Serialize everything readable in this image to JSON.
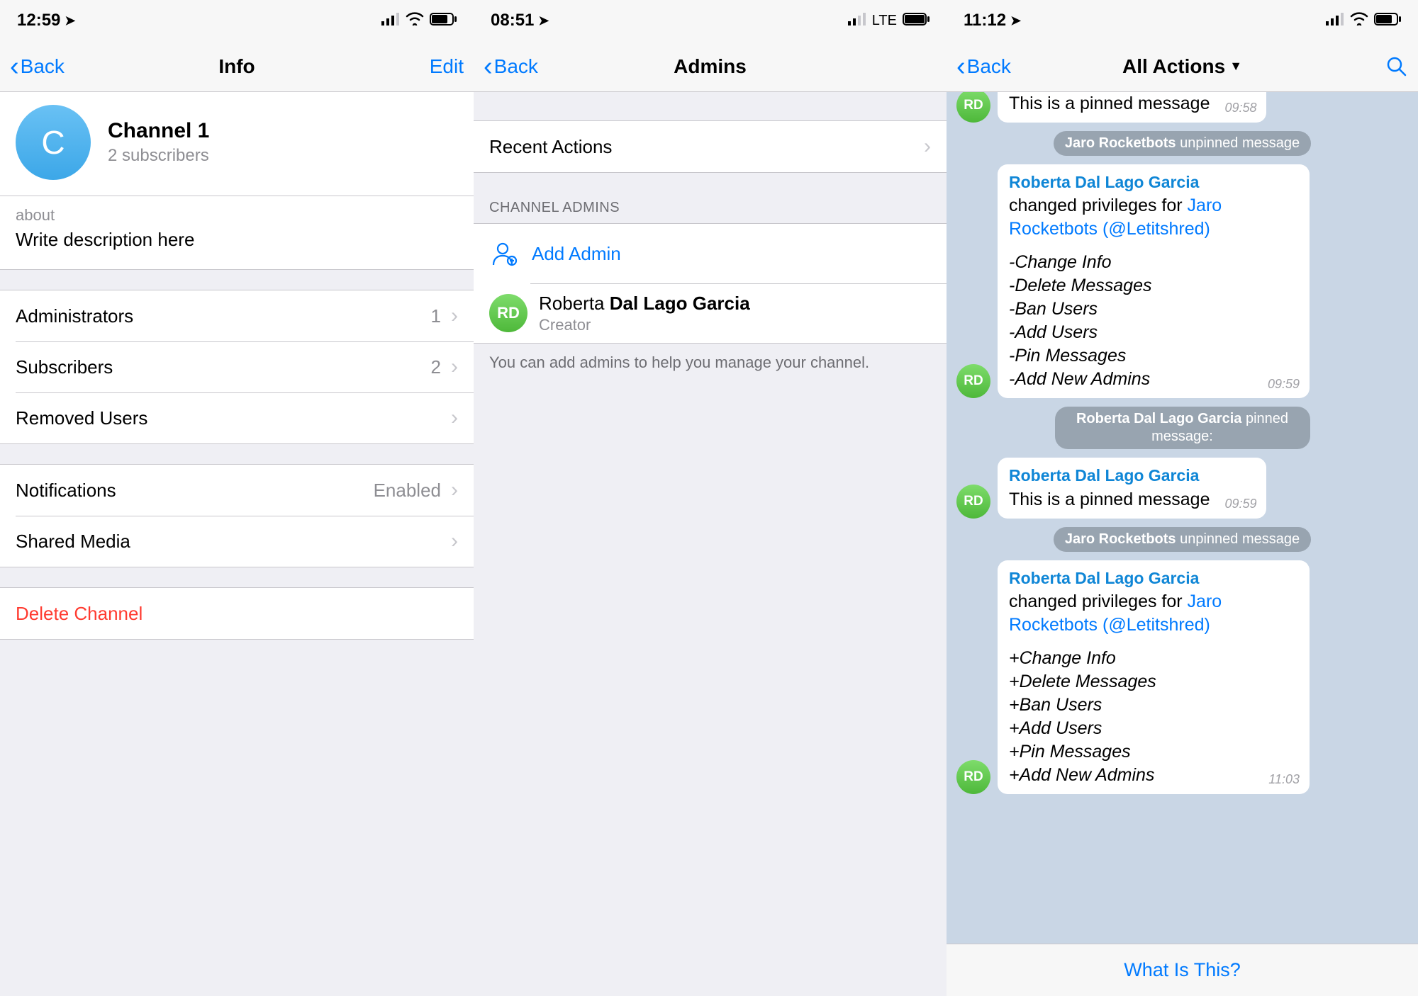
{
  "screen1": {
    "status": {
      "time": "12:59",
      "carrier": ""
    },
    "nav": {
      "back": "Back",
      "title": "Info",
      "edit": "Edit"
    },
    "channel": {
      "avatar_letter": "C",
      "name": "Channel 1",
      "subscribers": "2 subscribers"
    },
    "about": {
      "label": "about",
      "text": "Write description here"
    },
    "rows": {
      "admins_label": "Administrators",
      "admins_value": "1",
      "subs_label": "Subscribers",
      "subs_value": "2",
      "removed_label": "Removed Users",
      "notif_label": "Notifications",
      "notif_value": "Enabled",
      "shared_label": "Shared Media",
      "delete_label": "Delete Channel"
    }
  },
  "screen2": {
    "status": {
      "time": "08:51",
      "net": "LTE"
    },
    "nav": {
      "back": "Back",
      "title": "Admins"
    },
    "recent_actions": "Recent Actions",
    "section_header": "CHANNEL ADMINS",
    "add_admin": "Add Admin",
    "admin": {
      "initials": "RD",
      "first": "Roberta ",
      "last": "Dal Lago Garcia",
      "role": "Creator"
    },
    "footer": "You can add admins to help you manage your channel."
  },
  "screen3": {
    "status": {
      "time": "11:12"
    },
    "nav": {
      "back": "Back",
      "title": "All Actions"
    },
    "bottom": "What Is This?",
    "initials": "RD",
    "sender": "Roberta Dal Lago Garcia",
    "jaro": "Jaro Rocketbots",
    "handle": "(@Letitshred)",
    "pinned_msg": "This is a pinned message",
    "changed_priv": "changed privileges for ",
    "sys_unpin": " unpinned message",
    "sys_pin_suffix": " pinned message:",
    "priv_minus": [
      "-Change Info",
      "-Delete Messages",
      "-Ban Users",
      "-Add Users",
      "-Pin Messages",
      "-Add New Admins"
    ],
    "priv_plus": [
      "+Change Info",
      "+Delete Messages",
      "+Ban Users",
      "+Add Users",
      "+Pin Messages",
      "+Add New Admins"
    ],
    "times": {
      "t1": "09:58",
      "t2": "09:59",
      "t3": "09:59",
      "t4": "11:03"
    }
  }
}
